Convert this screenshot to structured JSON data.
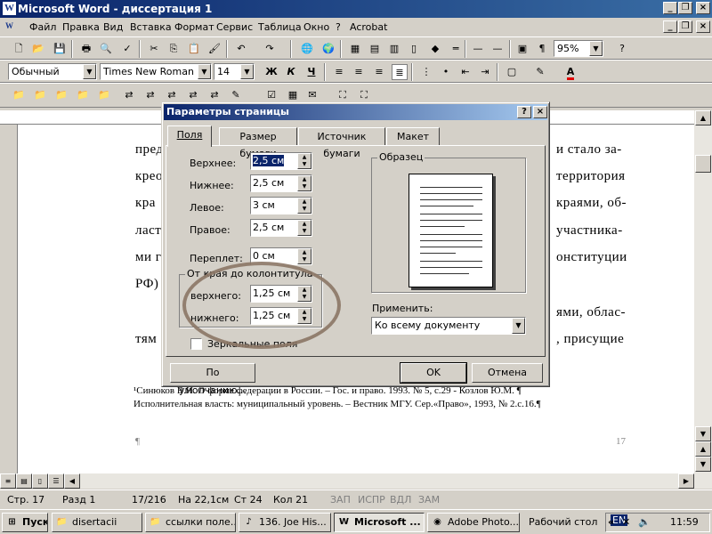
{
  "window": {
    "title": "Microsoft Word - диссертация 1"
  },
  "menu": [
    "Файл",
    "Правка",
    "Вид",
    "Вставка",
    "Формат",
    "Сервис",
    "Таблица",
    "Окно",
    "?",
    "Acrobat"
  ],
  "toolbar": {
    "zoom": "95%",
    "style": "Обычный",
    "font": "Times New Roman",
    "size": "14",
    "bold": "Ж",
    "italic": "К",
    "underline": "Ч"
  },
  "document": {
    "lines_left": [
      "пред",
      "крео",
      "кра",
      "ласт",
      "ми г",
      "РФ)"
    ],
    "lines_right": [
      "и стало за-",
      "территория",
      "краями, об-",
      "участника-",
      "онституции",
      "ями, облас-",
      ", присущие"
    ],
    "line7_left": "тям",
    "footnote1": "¹Синюков В.Н. О форме федерации в России. – Гос. и право. 1993. № 5, с.29 - Козлов Ю.М. ¶",
    "footnote2": "Исполнительная власть: муниципальный уровень. – Вестник МГУ. Сер.«Право», 1993, № 2.с.16.¶",
    "pilcrow": "¶",
    "page_num": "17"
  },
  "dialog": {
    "title": "Параметры страницы",
    "tabs": [
      "Поля",
      "Размер бумаги",
      "Источник бумаги",
      "Макет"
    ],
    "fields": {
      "top": {
        "label": "Верхнее:",
        "value": "2,5 см"
      },
      "bottom": {
        "label": "Нижнее:",
        "value": "2,5 см"
      },
      "left": {
        "label": "Левое:",
        "value": "3 см"
      },
      "right": {
        "label": "Правое:",
        "value": "2,5 см"
      },
      "gutter": {
        "label": "Переплет:",
        "value": "0 см"
      }
    },
    "header_group": {
      "label": "От края до колонтитула",
      "header_label": "верхнего:",
      "header_value": "1,25 см",
      "footer_label": "нижнего:",
      "footer_value": "1,25 см"
    },
    "mirror": "Зеркальные поля",
    "preview_label": "Образец",
    "apply_label": "Применить:",
    "apply_value": "Ко всему документу",
    "default_btn": "По умолчанию...",
    "ok": "OK",
    "cancel": "Отмена"
  },
  "status": {
    "page": "Стр. 17",
    "section": "Разд 1",
    "pages": "17/216",
    "at": "На 22,1см",
    "line": "Ст 24",
    "col": "Кол 21",
    "rec": "ЗАП",
    "trk": "ИСПР",
    "ext": "ВДЛ",
    "ovr": "ЗАМ"
  },
  "taskbar": {
    "start": "Пуск",
    "tasks": [
      "disertacii",
      "ссылки поле...",
      "136. Joe His...",
      "Microsoft ...",
      "Adobe Photo..."
    ],
    "desktop": "Рабочий стол",
    "lang": "EN",
    "clock": "11:59"
  }
}
